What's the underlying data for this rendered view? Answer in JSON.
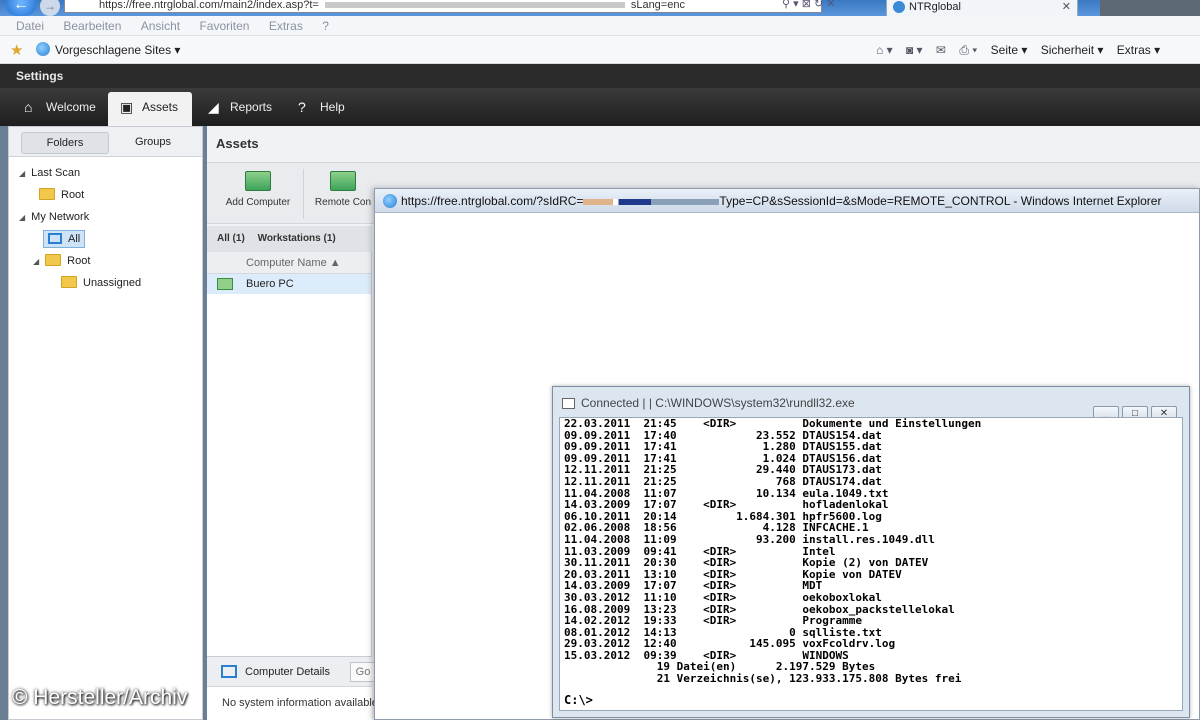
{
  "browser": {
    "url_prefix": "https://free.ntrglobal.com/main2/index.asp?t=",
    "url_suffix": "sLang=enc",
    "tab_title": "NTRglobal",
    "menu": [
      "Datei",
      "Bearbeiten",
      "Ansicht",
      "Favoriten",
      "Extras",
      "?"
    ],
    "favorites_label": "Vorgeschlagene Sites ▾",
    "toolbar": {
      "page": "Seite ▾",
      "security": "Sicherheit ▾",
      "tools": "Extras ▾"
    }
  },
  "app": {
    "section_title": "Settings",
    "nav": [
      {
        "label": "Welcome",
        "icon": "home-icon"
      },
      {
        "label": "Assets",
        "icon": "monitor-icon"
      },
      {
        "label": "Reports",
        "icon": "chart-icon"
      },
      {
        "label": "Help",
        "icon": "help-icon"
      }
    ]
  },
  "left_panel": {
    "tabs": [
      "Folders",
      "Groups"
    ],
    "tree": {
      "last_scan": "Last Scan",
      "root1": "Root",
      "my_network": "My Network",
      "all": "All",
      "root2": "Root",
      "unassigned": "Unassigned"
    }
  },
  "assets": {
    "title": "Assets",
    "tools": [
      "Add Computer",
      "Remote Con"
    ],
    "filters": [
      "All (1)",
      "Workstations (1)"
    ],
    "list_header": "Computer Name ▲",
    "rows": [
      "Buero PC"
    ],
    "details_label": "Computer Details",
    "go_label": "Go",
    "details_text": "No system information available"
  },
  "remote_window": {
    "title_prefix": "https://free.ntrglobal.com/?sIdRC=",
    "title_suffix": "Type=CP&sSessionId=&sMode=REMOTE_CONTROL - Windows Internet Explorer"
  },
  "cmd_window": {
    "title": "Connected |   | C:\\WINDOWS\\system32\\rundll32.exe",
    "lines": [
      "22.03.2011  21:45    <DIR>          Dokumente und Einstellungen",
      "09.09.2011  17:40            23.552 DTAUS154.dat",
      "09.09.2011  17:41             1.280 DTAUS155.dat",
      "09.09.2011  17:41             1.024 DTAUS156.dat",
      "12.11.2011  21:25            29.440 DTAUS173.dat",
      "12.11.2011  21:25               768 DTAUS174.dat",
      "11.04.2008  11:07            10.134 eula.1049.txt",
      "14.03.2009  17:07    <DIR>          hofladenlokal",
      "06.10.2011  20:14         1.684.301 hpfr5600.log",
      "02.06.2008  18:56             4.128 INFCACHE.1",
      "11.04.2008  11:09            93.200 install.res.1049.dll",
      "11.03.2009  09:41    <DIR>          Intel",
      "30.11.2011  20:30    <DIR>          Kopie (2) von DATEV",
      "20.03.2011  13:10    <DIR>          Kopie von DATEV",
      "14.03.2009  17:07    <DIR>          MDT",
      "30.03.2012  11:10    <DIR>          oekoboxlokal",
      "16.08.2009  13:23    <DIR>          oekobox_packstellelokal",
      "14.02.2012  19:33    <DIR>          Programme",
      "08.01.2012  14:13                 0 sqlliste.txt",
      "29.03.2012  12:40           145.095 voxFcoldrv.log",
      "15.03.2012  09:39    <DIR>          WINDOWS",
      "              19 Datei(en)      2.197.529 Bytes",
      "              21 Verzeichnis(se), 123.933.175.808 Bytes frei"
    ],
    "prompt": "C:\\>"
  },
  "watermark": "© Hersteller/Archiv"
}
